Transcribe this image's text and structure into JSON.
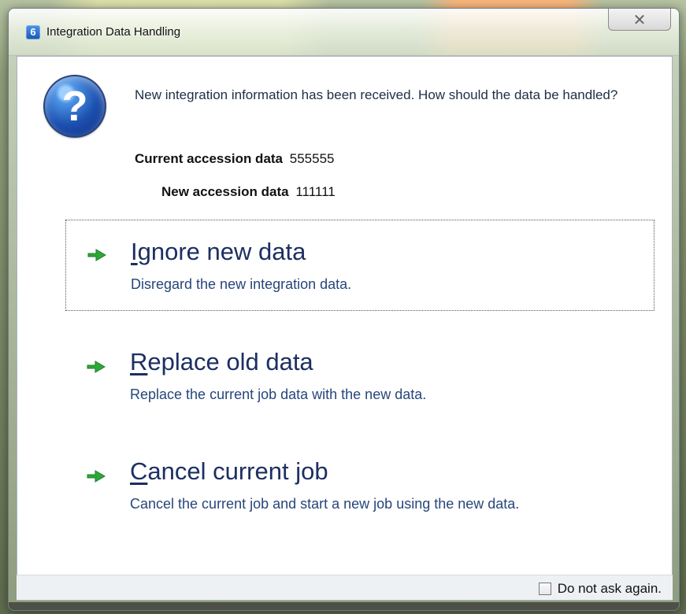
{
  "window": {
    "title": "Integration Data Handling",
    "close_symbol": "✕",
    "icon_letter": "6"
  },
  "message": {
    "text": "New integration information has been received.  How should the data be handled?"
  },
  "accession": {
    "current_label": "Current accession data",
    "current_value": "555555",
    "new_label": "New accession data",
    "new_value": "111111"
  },
  "options": [
    {
      "title_prefix": "",
      "title_mnemonic": "I",
      "title_rest": "gnore new data",
      "description": "Disregard the new integration data."
    },
    {
      "title_prefix": "",
      "title_mnemonic": "R",
      "title_rest": "eplace old data",
      "description": "Replace the current job data with the new data."
    },
    {
      "title_prefix": "",
      "title_mnemonic": "C",
      "title_rest": "ancel current job",
      "description": "Cancel the current job and start a new job using the new data."
    }
  ],
  "footer": {
    "checkbox_label": "Do not ask again."
  },
  "icons": {
    "question": "?",
    "arrow": "right-arrow-icon"
  },
  "colors": {
    "accent_text": "#1c2f62",
    "arrow_green": "#2ea739",
    "question_blue": "#1c4fae"
  }
}
